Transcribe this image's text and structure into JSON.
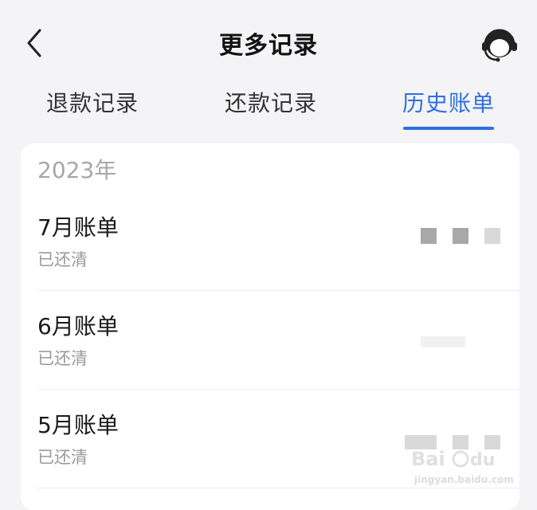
{
  "header": {
    "title": "更多记录",
    "back_icon": "chevron-left-icon",
    "service_icon": "customer-service-headset-icon"
  },
  "tabs": [
    {
      "label": "退款记录",
      "active": false
    },
    {
      "label": "还款记录",
      "active": false
    },
    {
      "label": "历史账单",
      "active": true
    }
  ],
  "bills": {
    "year": "2023年",
    "items": [
      {
        "title": "7月账单",
        "status": "已还清"
      },
      {
        "title": "6月账单",
        "status": "已还清"
      },
      {
        "title": "5月账单",
        "status": "已还清"
      }
    ]
  },
  "colors": {
    "accent": "#2f6fe0",
    "background": "#f4f4f6",
    "card": "#ffffff",
    "muted_text": "#9a9a9a"
  }
}
